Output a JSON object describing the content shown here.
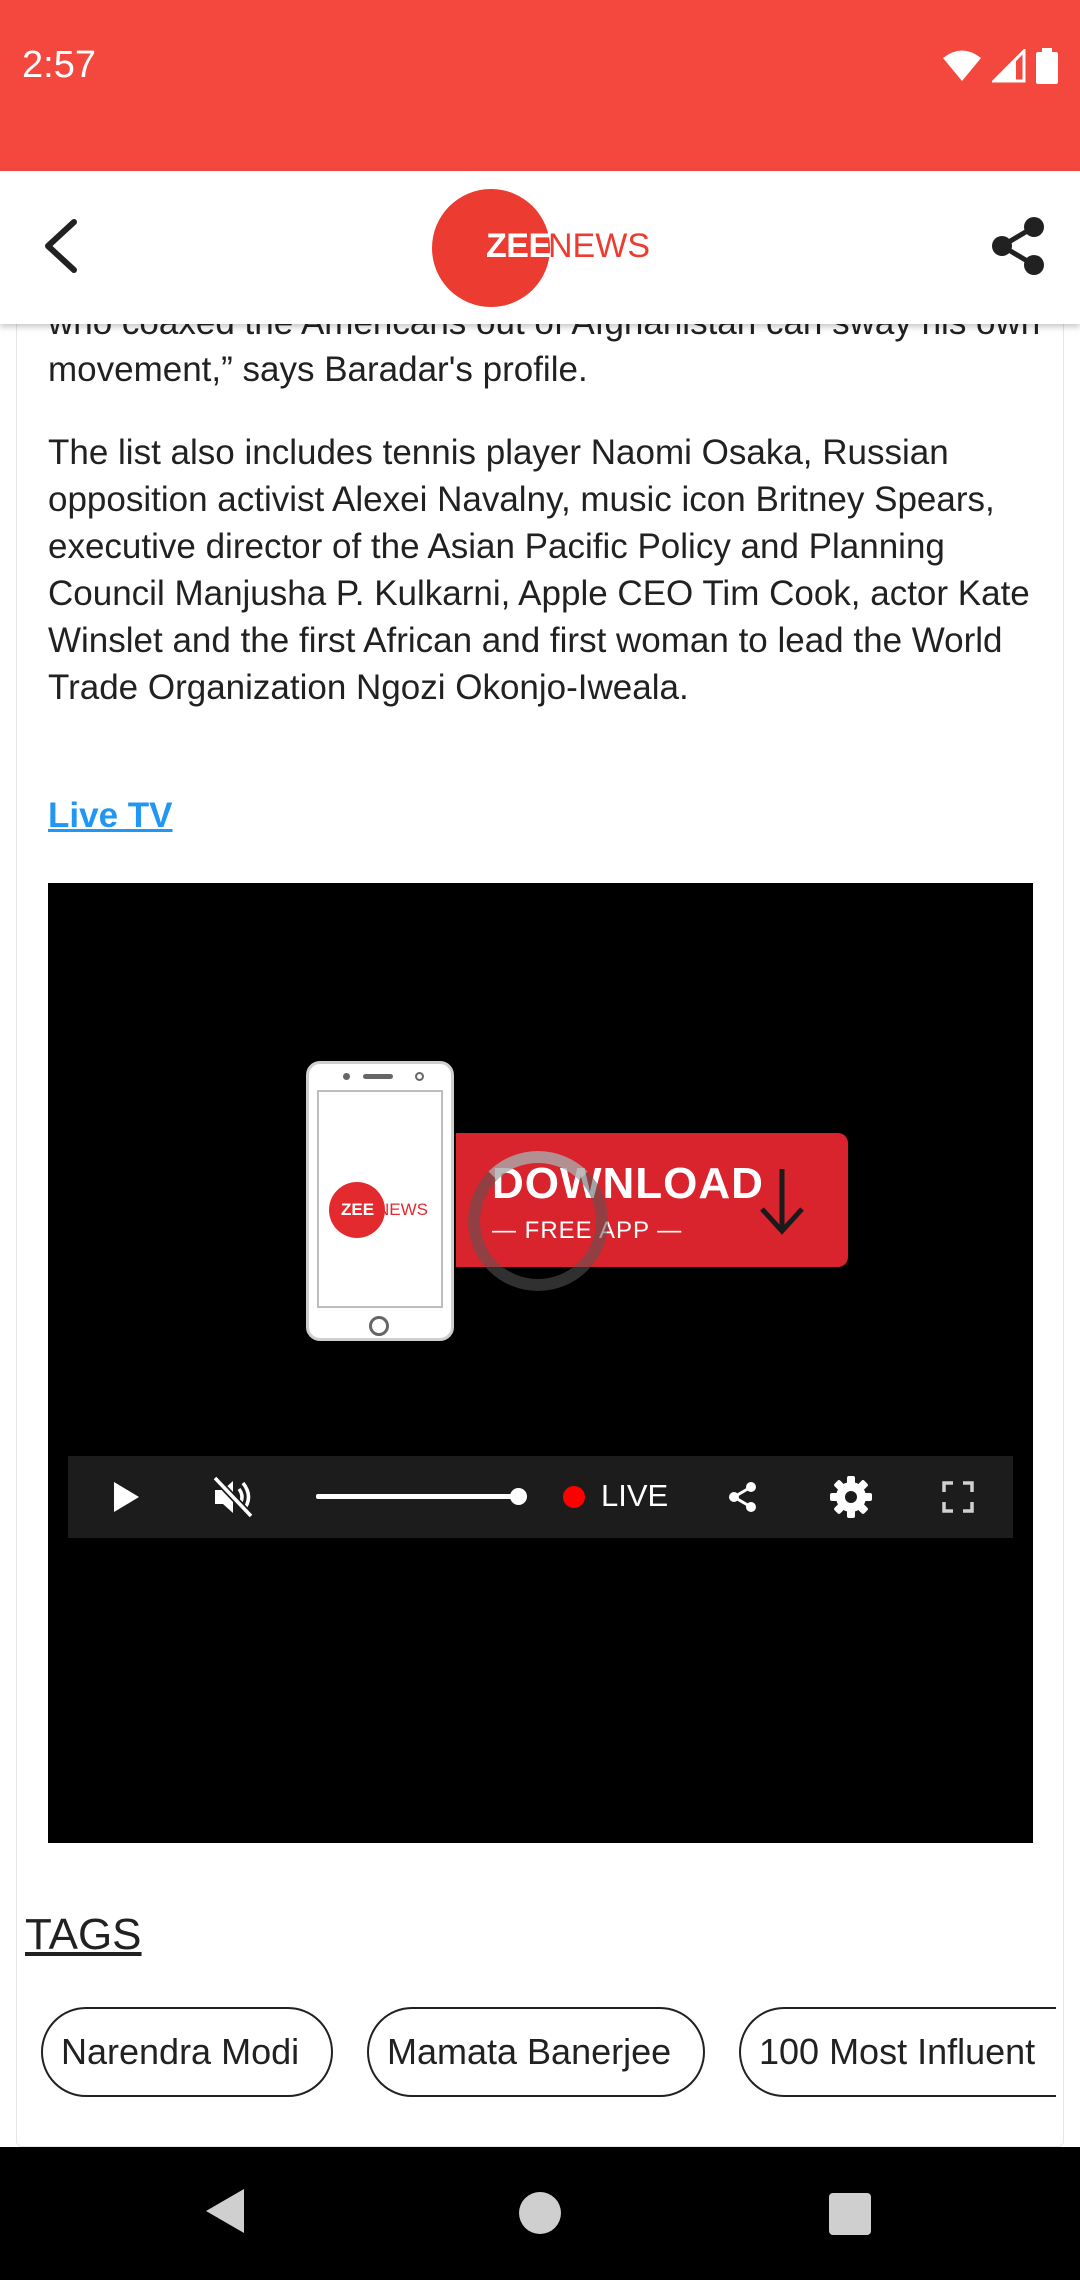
{
  "status_bar": {
    "time": "2:57",
    "bg_color": "#f4473d"
  },
  "app_bar": {
    "logo_part1": "ZEE",
    "logo_part2": "NEWS",
    "back_icon": "back-arrow-icon",
    "share_icon": "share-icon"
  },
  "article": {
    "paragraphs": [
      "who coaxed the Americans out of Afghanistan can sway his own movement,” says Baradar's profile.",
      "The list also includes tennis player Naomi Osaka, Russian opposition activist Alexei Navalny, music icon Britney Spears, executive director of the Asian Pacific Policy and Planning Council Manjusha P. Kulkarni, Apple CEO Tim Cook, actor Kate Winslet and the first African and first woman to lead the World Trade Organization Ngozi Okonjo-Iweala."
    ],
    "live_tv_link": "Live TV"
  },
  "video": {
    "promo_logo_part1": "ZEE",
    "promo_logo_part2": "NEWS",
    "promo_title": "DOWNLOAD",
    "promo_subtitle": "— FREE APP —",
    "live_label": "LIVE",
    "volume_level": 1.0,
    "muted": true
  },
  "tags": {
    "title": "TAGS",
    "items": [
      "Narendra Modi",
      "Mamata Banerjee",
      "100 Most Influent"
    ]
  },
  "colors": {
    "brand_red": "#ec3b30",
    "link_blue": "#2196f3"
  }
}
